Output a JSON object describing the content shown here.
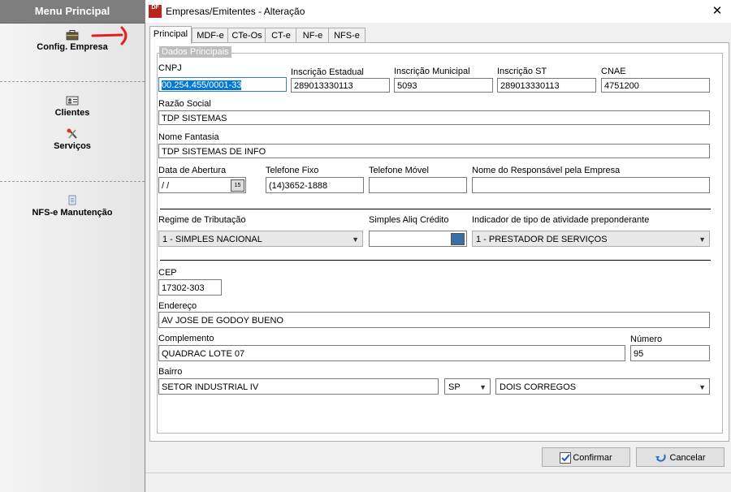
{
  "menu": {
    "header": "Menu Principal",
    "items": [
      {
        "label": "Config. Empresa",
        "icon": "briefcase-icon"
      },
      {
        "label": "Clientes",
        "icon": "id-card-icon"
      },
      {
        "label": "Serviços",
        "icon": "tools-icon"
      },
      {
        "label": "NFS-e Manutenção",
        "icon": "document-icon"
      }
    ]
  },
  "dialog": {
    "title": "Empresas/Emitentes - Alteração",
    "app_icon_text": "DF",
    "close": "✕",
    "tabs": [
      "Principal",
      "MDF-e",
      "CTe-Os",
      "CT-e",
      "NF-e",
      "NFS-e"
    ],
    "group_label": "Dados Principais",
    "fields": {
      "cnpj": {
        "label": "CNPJ",
        "value": "00.254.455/0001-33"
      },
      "ie": {
        "label": "Inscrição Estadual",
        "value": "289013330113"
      },
      "im": {
        "label": "Inscrição Municipal",
        "value": "5093"
      },
      "ist": {
        "label": "Inscrição ST",
        "value": "289013330113"
      },
      "cnae": {
        "label": "CNAE",
        "value": "4751200"
      },
      "razao": {
        "label": "Razão Social",
        "value": "TDP SISTEMAS"
      },
      "fantasia": {
        "label": "Nome Fantasia",
        "value": "TDP SISTEMAS DE INFO"
      },
      "abertura": {
        "label": "Data de Abertura",
        "value": " /  /",
        "btn": "15"
      },
      "fone_fixo": {
        "label": "Telefone Fixo",
        "value": "(14)3652-1888"
      },
      "fone_movel": {
        "label": "Telefone Móvel",
        "value": ""
      },
      "responsavel": {
        "label": "Nome do Responsável pela Empresa",
        "value": ""
      },
      "regime": {
        "label": "Regime de Tributação",
        "value": "1 - SIMPLES NACIONAL"
      },
      "aliq": {
        "label": "Simples Aliq Crédito",
        "value": ""
      },
      "atividade": {
        "label": "Indicador de tipo de atividade preponderante",
        "value": "1 - PRESTADOR DE SERVIÇOS"
      },
      "cep": {
        "label": "CEP",
        "value": "17302-303"
      },
      "endereco": {
        "label": "Endereço",
        "value": "AV JOSE DE GODOY BUENO"
      },
      "complemento": {
        "label": "Complemento",
        "value": "QUADRAC LOTE 07"
      },
      "numero": {
        "label": "Número",
        "value": "95"
      },
      "bairro": {
        "label": "Bairro",
        "value": "SETOR INDUSTRIAL IV"
      },
      "uf": {
        "value": "SP"
      },
      "cidade": {
        "value": "DOIS CORREGOS"
      }
    },
    "buttons": {
      "confirm": "Confirmar",
      "cancel": "Cancelar"
    }
  },
  "colors": {
    "accent": "#b8271e",
    "selection": "#0078d7",
    "menu_header": "#7d7d7d"
  }
}
